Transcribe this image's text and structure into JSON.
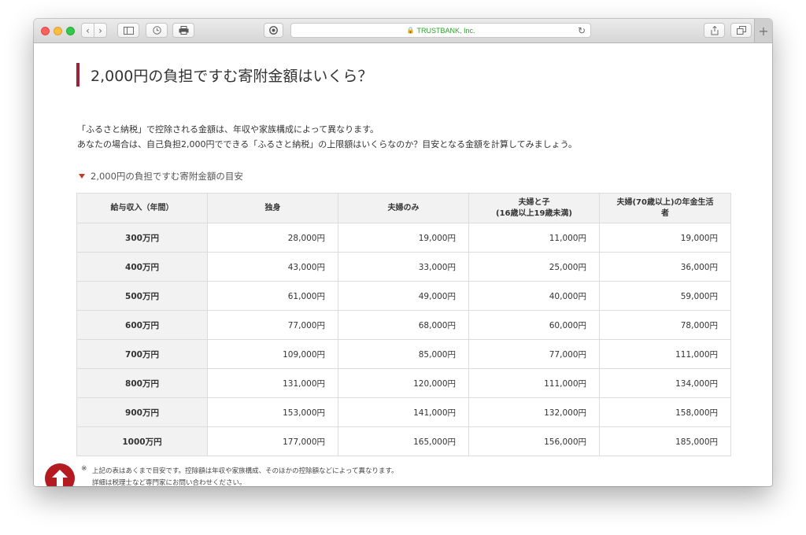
{
  "browser": {
    "address": "TRUSTBANK, Inc.",
    "accent_green": "#2f9d2f"
  },
  "page": {
    "title": "2,000円の負担ですむ寄附金額はいくら？",
    "intro_line1": "「ふるさと納税」で控除される金額は、年収や家族構成によって異なります。",
    "intro_line2": "あなたの場合は、自己負担2,000円でできる「ふるさと納税」の上限額はいくらなのか？目安となる金額を計算してみましょう。",
    "section_title": "2,000円の負担ですむ寄附金額の目安",
    "accent_color": "#9b2335"
  },
  "table": {
    "headers": {
      "h0": "給与収入（年間）",
      "h1": "独身",
      "h2": "夫婦のみ",
      "h3a": "夫婦と子",
      "h3b": "(16歳以上19歳未満)",
      "h4a": "夫婦(70歳以上)の年金生活",
      "h4b": "者"
    },
    "rows": [
      {
        "income": "300万円",
        "single": "28,000円",
        "couple": "19,000円",
        "couple_child": "11,000円",
        "pension": "19,000円"
      },
      {
        "income": "400万円",
        "single": "43,000円",
        "couple": "33,000円",
        "couple_child": "25,000円",
        "pension": "36,000円"
      },
      {
        "income": "500万円",
        "single": "61,000円",
        "couple": "49,000円",
        "couple_child": "40,000円",
        "pension": "59,000円"
      },
      {
        "income": "600万円",
        "single": "77,000円",
        "couple": "68,000円",
        "couple_child": "60,000円",
        "pension": "78,000円"
      },
      {
        "income": "700万円",
        "single": "109,000円",
        "couple": "85,000円",
        "couple_child": "77,000円",
        "pension": "111,000円"
      },
      {
        "income": "800万円",
        "single": "131,000円",
        "couple": "120,000円",
        "couple_child": "111,000円",
        "pension": "134,000円"
      },
      {
        "income": "900万円",
        "single": "153,000円",
        "couple": "141,000円",
        "couple_child": "132,000円",
        "pension": "158,000円"
      },
      {
        "income": "1000万円",
        "single": "177,000円",
        "couple": "165,000円",
        "couple_child": "156,000円",
        "pension": "185,000円"
      }
    ]
  },
  "footnote": {
    "mark": "※",
    "line1": "上記の表はあくまで目安です。控除額は年収や家族構成、そのほかの控除額などによって異なります。",
    "line2": "詳細は税理士など専門家にお問い合わせください。"
  },
  "icons": {
    "back": "chevron-left-icon",
    "forward": "chevron-right-icon",
    "sidebar": "sidebar-icon",
    "history": "clock-icon",
    "print": "printer-icon",
    "reader": "reader-icon",
    "lock": "lock-icon",
    "reload": "reload-icon",
    "share": "share-icon",
    "tabs": "tabs-icon",
    "scroll_top": "arrow-up-icon"
  }
}
